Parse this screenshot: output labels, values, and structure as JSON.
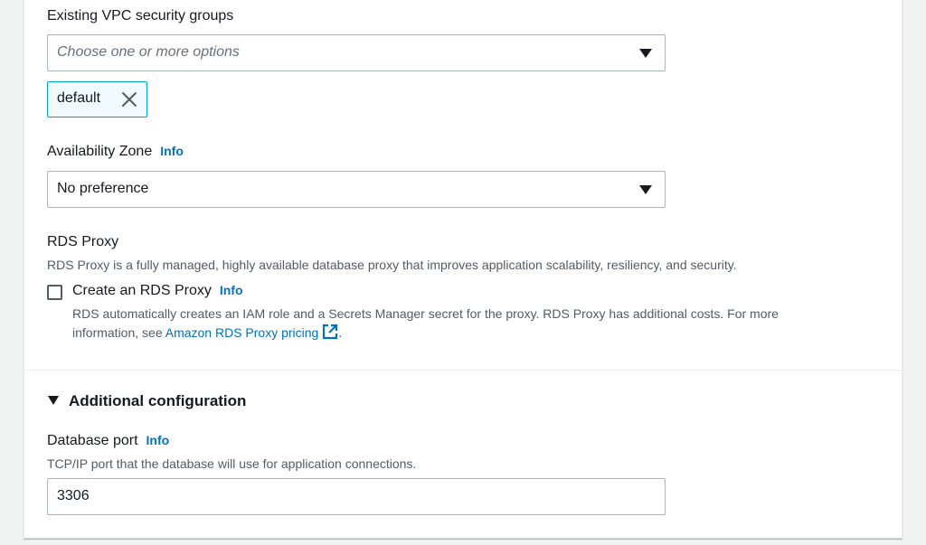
{
  "security_groups": {
    "label": "Existing VPC security groups",
    "placeholder": "Choose one or more options",
    "tokens": [
      "default"
    ]
  },
  "availability_zone": {
    "label": "Availability Zone",
    "info": "Info",
    "value": "No preference"
  },
  "rds_proxy": {
    "label": "RDS Proxy",
    "description": "RDS Proxy is a fully managed, highly available database proxy that improves application scalability, resiliency, and security.",
    "checkbox_label": "Create an RDS Proxy",
    "info": "Info",
    "checked": false,
    "help_line1": "RDS automatically creates an IAM role and a Secrets Manager secret for the proxy. RDS Proxy has additional costs. For more",
    "help_line2_prefix": "information, see ",
    "pricing_link": "Amazon RDS Proxy pricing",
    "help_line2_suffix": "."
  },
  "additional_configuration": {
    "title": "Additional configuration",
    "expanded": true
  },
  "database_port": {
    "label": "Database port",
    "info": "Info",
    "description": "TCP/IP port that the database will use for application connections.",
    "value": "3306"
  },
  "colors": {
    "link": "#0073bb",
    "token_border": "#00a1c9",
    "token_bg": "#f1faff",
    "border": "#aab7b8"
  }
}
